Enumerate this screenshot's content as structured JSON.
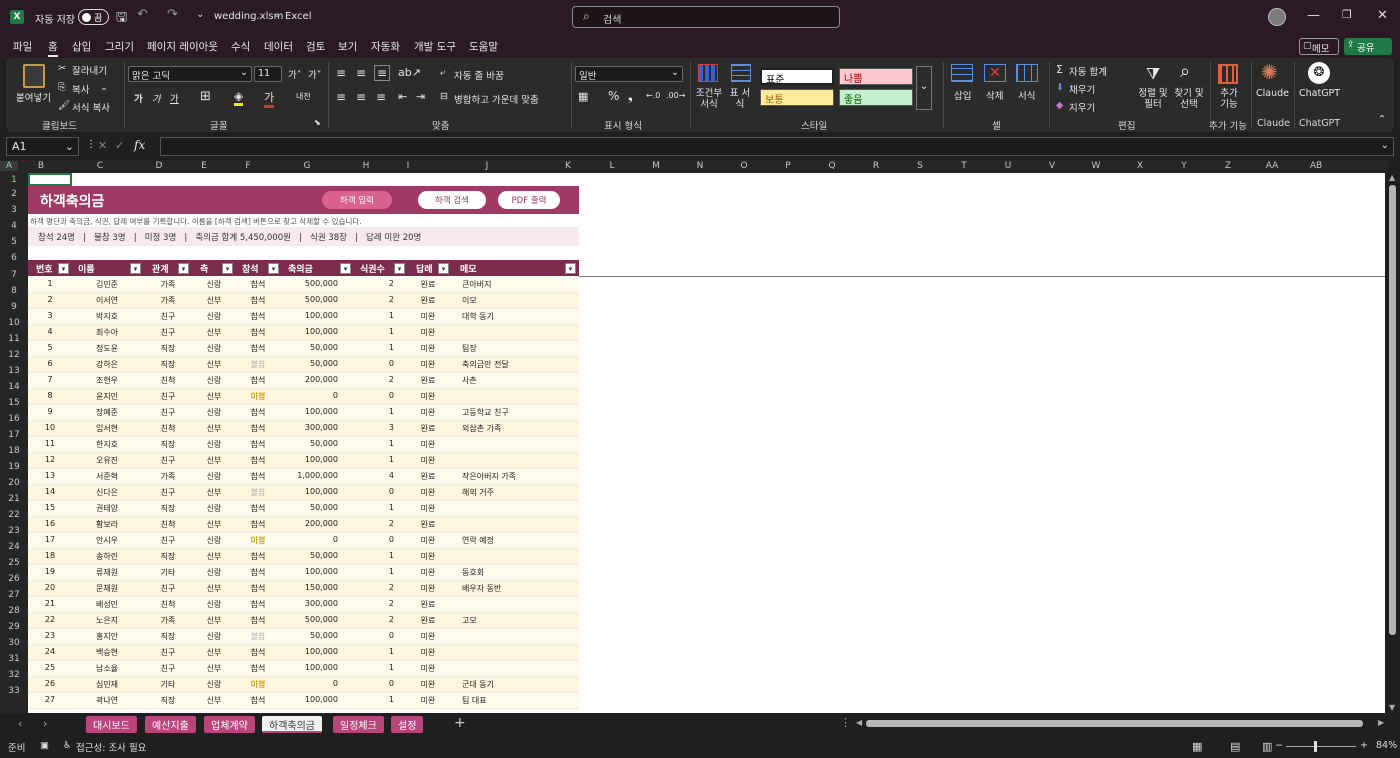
{
  "titlebar": {
    "autosave": "자동 저장",
    "toggle": "끔",
    "filename": "wedding.xlsm",
    "dash": "-",
    "app": "Excel",
    "search_placeholder": "검색"
  },
  "menu": {
    "items": [
      "파일",
      "홈",
      "삽입",
      "그리기",
      "페이지 레이아웃",
      "수식",
      "데이터",
      "검토",
      "보기",
      "자동화",
      "개발 도구",
      "도움말"
    ],
    "memo": "메모",
    "share": "공유"
  },
  "ribbon": {
    "clipboard": {
      "paste": "붙여넣기",
      "cut": "잘라내기",
      "copy": "복사",
      "format_painter": "서식 복사",
      "label": "클립보드"
    },
    "font": {
      "name": "맑은 고딕",
      "size": "11",
      "label": "글꼴"
    },
    "align": {
      "wrap": "자동 줄 바꿈",
      "merge": "병합하고 가운데 맞춤",
      "label": "맞춤"
    },
    "number": {
      "format": "일반",
      "label": "표시 형식"
    },
    "style": {
      "cond": "조건부 서식",
      "table": "표 서식",
      "normal": "표준",
      "bad": "나쁨",
      "neutral": "보통",
      "good": "좋음",
      "label": "스타일"
    },
    "cells": {
      "insert": "삽입",
      "delete": "삭제",
      "format": "서식",
      "label": "셀"
    },
    "edit": {
      "autosum": "자동 합계",
      "fill": "채우기",
      "clear": "지우기",
      "sort": "정렬 및 필터",
      "find": "찾기 및 선택",
      "label": "편집"
    },
    "addins": {
      "add": "추가 기능",
      "label": "추가 기능"
    },
    "claude": {
      "name": "Claude",
      "label": "Claude"
    },
    "chatgpt": {
      "name": "ChatGPT",
      "label": "ChatGPT"
    }
  },
  "formula": {
    "namebox": "A1",
    "fx": "fx"
  },
  "columns": [
    "A",
    "B",
    "C",
    "D",
    "E",
    "F",
    "G",
    "H",
    "I",
    "J",
    "K",
    "L",
    "M",
    "N",
    "O",
    "P",
    "Q",
    "R",
    "S",
    "T",
    "U",
    "V",
    "W",
    "X",
    "Y",
    "Z",
    "AA",
    "AB"
  ],
  "rows": [
    "1",
    "2",
    "3",
    "4",
    "5",
    "6",
    "7",
    "8",
    "9",
    "10",
    "11",
    "12",
    "13",
    "14",
    "15",
    "16",
    "17",
    "18",
    "19",
    "20",
    "21",
    "22",
    "23",
    "24",
    "25",
    "26",
    "27",
    "28",
    "29",
    "30",
    "31",
    "32",
    "33"
  ],
  "sheet": {
    "title": "하객축의금",
    "buttons": [
      "하객 입력",
      "하객 검색",
      "PDF 출력"
    ],
    "description": "하객 명단과 축의금, 식권, 답례 여부를 기록합니다. 이름을 [하객 검색] 버튼으로 찾고 삭제할 수 있습니다.",
    "summary": "참석 24명   |   불참 3명   |   미정 3명   |   축의금 합계 5,450,000원   |   식권 38장   |   답례 미완 20명",
    "headers": [
      "번호",
      "이름",
      "관계",
      "측",
      "참석",
      "축의금",
      "식권수",
      "답례",
      "메모"
    ],
    "rows": [
      [
        "1",
        "김민준",
        "가족",
        "신랑",
        "참석",
        "500,000",
        "2",
        "완료",
        "큰아버지"
      ],
      [
        "2",
        "이서연",
        "가족",
        "신부",
        "참석",
        "500,000",
        "2",
        "완료",
        "이모"
      ],
      [
        "3",
        "박지호",
        "친구",
        "신랑",
        "참석",
        "100,000",
        "1",
        "미완",
        "대학 동기"
      ],
      [
        "4",
        "최수아",
        "친구",
        "신부",
        "참석",
        "100,000",
        "1",
        "미완",
        ""
      ],
      [
        "5",
        "정도윤",
        "직장",
        "신랑",
        "참석",
        "50,000",
        "1",
        "미완",
        "팀장"
      ],
      [
        "6",
        "강하은",
        "직장",
        "신부",
        "불참",
        "50,000",
        "0",
        "미완",
        "축의금만 전달"
      ],
      [
        "7",
        "조현우",
        "친척",
        "신랑",
        "참석",
        "200,000",
        "2",
        "완료",
        "사촌"
      ],
      [
        "8",
        "윤지민",
        "친구",
        "신부",
        "미정",
        "0",
        "0",
        "미완",
        ""
      ],
      [
        "9",
        "장예준",
        "친구",
        "신랑",
        "참석",
        "100,000",
        "1",
        "미완",
        "고등학교 친구"
      ],
      [
        "10",
        "임서현",
        "친척",
        "신부",
        "참석",
        "300,000",
        "3",
        "완료",
        "외삼촌 가족"
      ],
      [
        "11",
        "한지호",
        "직장",
        "신랑",
        "참석",
        "50,000",
        "1",
        "미완",
        ""
      ],
      [
        "12",
        "오유진",
        "친구",
        "신부",
        "참석",
        "100,000",
        "1",
        "미완",
        ""
      ],
      [
        "13",
        "서준혁",
        "가족",
        "신랑",
        "참석",
        "1,000,000",
        "4",
        "완료",
        "작은아버지 가족"
      ],
      [
        "14",
        "신다은",
        "친구",
        "신부",
        "불참",
        "100,000",
        "0",
        "미완",
        "해외 거주"
      ],
      [
        "15",
        "권태양",
        "직장",
        "신랑",
        "참석",
        "50,000",
        "1",
        "미완",
        ""
      ],
      [
        "16",
        "황보라",
        "친척",
        "신부",
        "참석",
        "200,000",
        "2",
        "완료",
        ""
      ],
      [
        "17",
        "안시우",
        "친구",
        "신랑",
        "미정",
        "0",
        "0",
        "미완",
        "연락 예정"
      ],
      [
        "18",
        "송하린",
        "직장",
        "신부",
        "참석",
        "50,000",
        "1",
        "미완",
        ""
      ],
      [
        "19",
        "류재원",
        "기타",
        "신랑",
        "참석",
        "100,000",
        "1",
        "미완",
        "동호회"
      ],
      [
        "20",
        "문채원",
        "친구",
        "신부",
        "참석",
        "150,000",
        "2",
        "미완",
        "배우자 동반"
      ],
      [
        "21",
        "배성민",
        "친척",
        "신랑",
        "참석",
        "300,000",
        "2",
        "완료",
        ""
      ],
      [
        "22",
        "노은지",
        "가족",
        "신부",
        "참석",
        "500,000",
        "2",
        "완료",
        "고모"
      ],
      [
        "23",
        "홍지안",
        "직장",
        "신랑",
        "불참",
        "50,000",
        "0",
        "미완",
        ""
      ],
      [
        "24",
        "백승현",
        "친구",
        "신부",
        "참석",
        "100,000",
        "1",
        "미완",
        ""
      ],
      [
        "25",
        "남소율",
        "친구",
        "신부",
        "참석",
        "100,000",
        "1",
        "미완",
        ""
      ],
      [
        "26",
        "심민재",
        "기타",
        "신랑",
        "미정",
        "0",
        "0",
        "미완",
        "군대 동기"
      ],
      [
        "27",
        "곽나연",
        "직장",
        "신부",
        "참석",
        "100,000",
        "1",
        "미완",
        "팀 대표"
      ]
    ]
  },
  "tabs": [
    "대시보드",
    "예산지출",
    "업체계약",
    "하객축의금",
    "일정체크",
    "설정"
  ],
  "active_tab": "하객축의금",
  "status": {
    "ready": "준비",
    "accessibility": "접근성: 조사 필요",
    "zoom": "84%"
  }
}
